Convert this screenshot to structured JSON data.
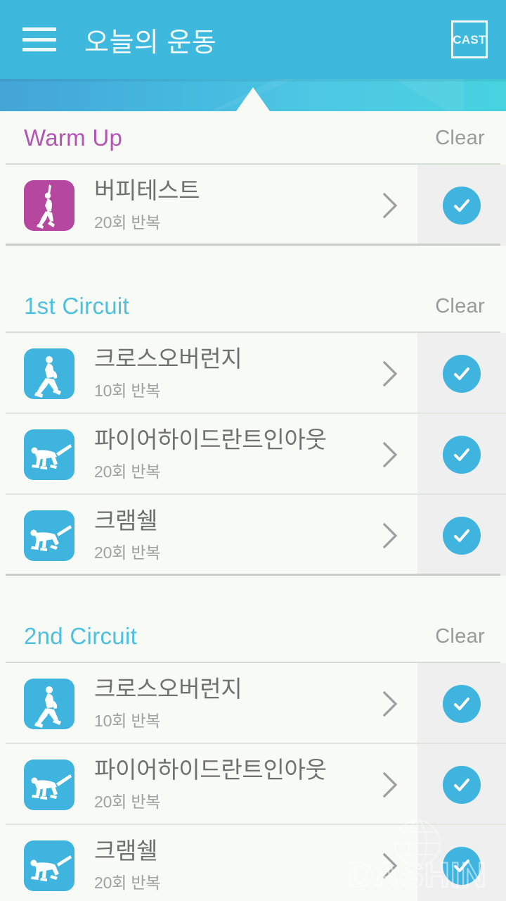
{
  "appbar": {
    "menu_icon": "hamburger-menu-icon",
    "title": "오늘의 운동",
    "cast_label": "CAST",
    "background_color": "#3fb8de"
  },
  "colors": {
    "accent_blue": "#3fb4df",
    "warmup_purple": "#b455b4",
    "circuit_blue": "#4ebfe0",
    "page_background": "#f7faf5",
    "check_panel": "#efeff0",
    "title_text": "#707070",
    "sub_text": "#a0a0a0",
    "clear_text": "#9a9a9a"
  },
  "clear_label": "Clear",
  "sections": [
    {
      "title": "Warm Up",
      "style": "warm",
      "clear": "Clear",
      "exercises": [
        {
          "name": "버피테스트",
          "reps": "20회 반복",
          "thumb_color": "purple",
          "thumb_icon": "burpee-figure-icon",
          "checked": true
        }
      ]
    },
    {
      "title": "1st Circuit",
      "style": "circuit",
      "clear": "Clear",
      "exercises": [
        {
          "name": "크로스오버런지",
          "reps": "10회 반복",
          "thumb_color": "blue",
          "thumb_icon": "lunge-figure-icon",
          "checked": true
        },
        {
          "name": "파이어하이드란트인아웃",
          "reps": "20회 반복",
          "thumb_color": "blue",
          "thumb_icon": "fire-hydrant-figure-icon",
          "checked": true
        },
        {
          "name": "크램쉘",
          "reps": "20회 반복",
          "thumb_color": "blue",
          "thumb_icon": "clamshell-figure-icon",
          "checked": true
        }
      ]
    },
    {
      "title": "2nd Circuit",
      "style": "circuit",
      "clear": "Clear",
      "exercises": [
        {
          "name": "크로스오버런지",
          "reps": "10회 반복",
          "thumb_color": "blue",
          "thumb_icon": "lunge-figure-icon",
          "checked": true
        },
        {
          "name": "파이어하이드란트인아웃",
          "reps": "20회 반복",
          "thumb_color": "blue",
          "thumb_icon": "fire-hydrant-figure-icon",
          "checked": true
        },
        {
          "name": "크램쉘",
          "reps": "20회 반복",
          "thumb_color": "blue",
          "thumb_icon": "clamshell-figure-icon",
          "checked": true
        }
      ]
    }
  ],
  "watermark": {
    "text": "DASHIN",
    "icon": "globe-icon"
  }
}
